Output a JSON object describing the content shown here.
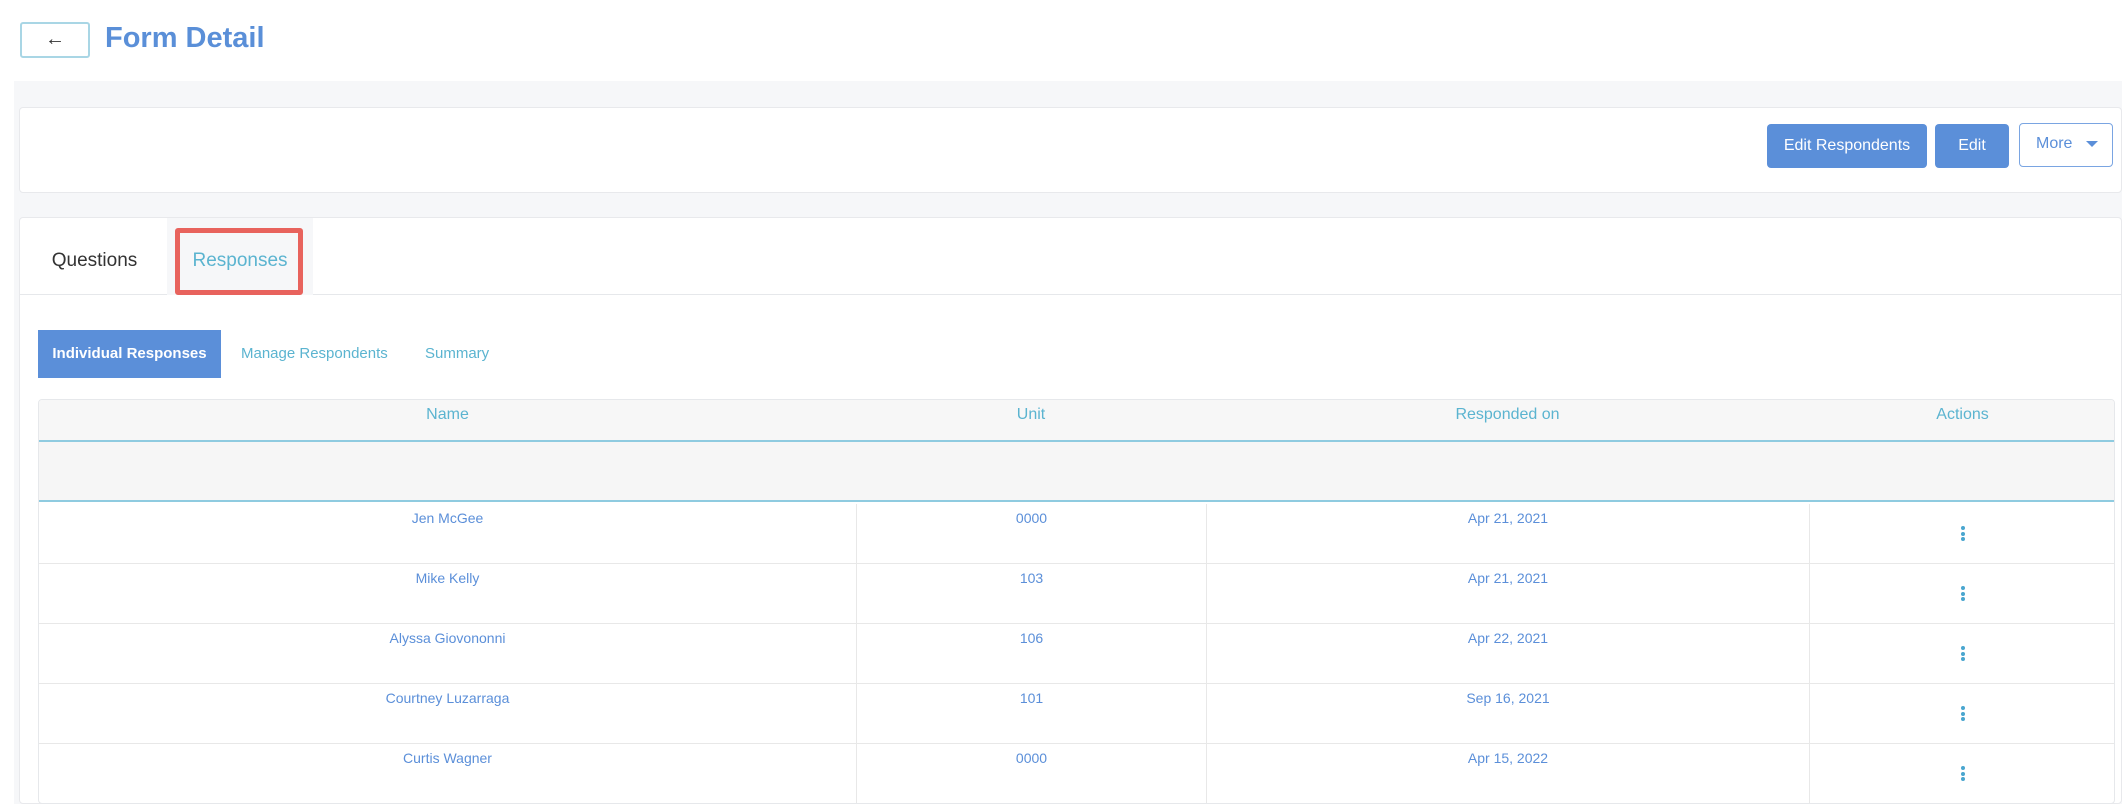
{
  "header": {
    "back_icon": "←",
    "title": "Form Detail"
  },
  "toolbar": {
    "edit_respondents": "Edit Respondents",
    "edit": "Edit",
    "more": "More"
  },
  "tabs": [
    {
      "label": "Questions"
    },
    {
      "label": "Responses",
      "active": true
    }
  ],
  "subtabs": [
    {
      "label": "Individual Responses",
      "active": true
    },
    {
      "label": "Manage Respondents"
    },
    {
      "label": "Summary"
    }
  ],
  "table": {
    "columns": [
      "Name",
      "Unit",
      "Responded on",
      "Actions"
    ],
    "rows": [
      {
        "name": "Jen McGee",
        "unit": "0000",
        "responded_on": "Apr 21, 2021"
      },
      {
        "name": "Mike Kelly",
        "unit": "103",
        "responded_on": "Apr 21, 2021"
      },
      {
        "name": "Alyssa Giovononni",
        "unit": "106",
        "responded_on": "Apr 22, 2021"
      },
      {
        "name": "Courtney Luzarraga",
        "unit": "101",
        "responded_on": "Sep 16, 2021"
      },
      {
        "name": "Curtis Wagner",
        "unit": "0000",
        "responded_on": "Apr 15, 2022"
      }
    ]
  }
}
